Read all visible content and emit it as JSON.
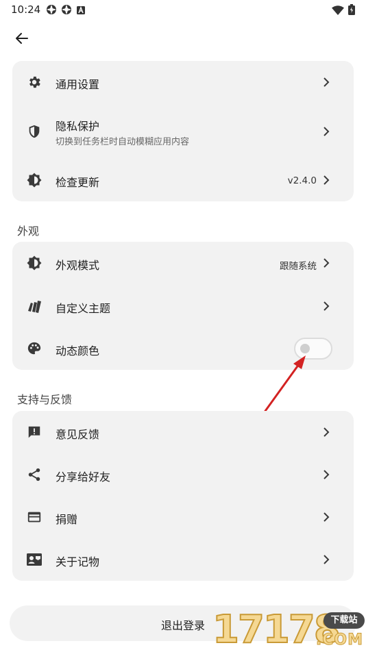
{
  "status_bar": {
    "time": "10:24",
    "left_icons": [
      "notification-icon",
      "notification-icon",
      "a-icon"
    ],
    "right_icons": [
      "wifi-icon",
      "battery-icon"
    ]
  },
  "header": {
    "back_icon": "arrow-left-icon"
  },
  "general_group": {
    "items": [
      {
        "icon": "gear-icon",
        "label": "通用设置"
      },
      {
        "icon": "shield-icon",
        "label": "隐私保护",
        "sublabel": "切换到任务栏时自动模糊应用内容"
      },
      {
        "icon": "brightness-icon",
        "label": "检查更新",
        "value": "v2.4.0"
      }
    ]
  },
  "appearance_section": {
    "title": "外观",
    "items": [
      {
        "icon": "brightness-icon",
        "label": "外观模式",
        "value": "跟随系统"
      },
      {
        "icon": "cards-icon",
        "label": "自定义主题"
      },
      {
        "icon": "palette-icon",
        "label": "动态颜色",
        "toggle_on": false
      }
    ]
  },
  "support_section": {
    "title": "支持与反馈",
    "items": [
      {
        "icon": "feedback-icon",
        "label": "意见反馈"
      },
      {
        "icon": "share-icon",
        "label": "分享给好友"
      },
      {
        "icon": "card-icon",
        "label": "捐赠"
      },
      {
        "icon": "contact-card-icon",
        "label": "关于记物"
      }
    ]
  },
  "logout": {
    "label": "退出登录"
  },
  "watermark": {
    "digits": "17178",
    "badge": "下载站",
    "suffix": ".COM"
  },
  "colors": {
    "card_bg": "#f2f2f2",
    "annotation_arrow": "#d32222"
  }
}
